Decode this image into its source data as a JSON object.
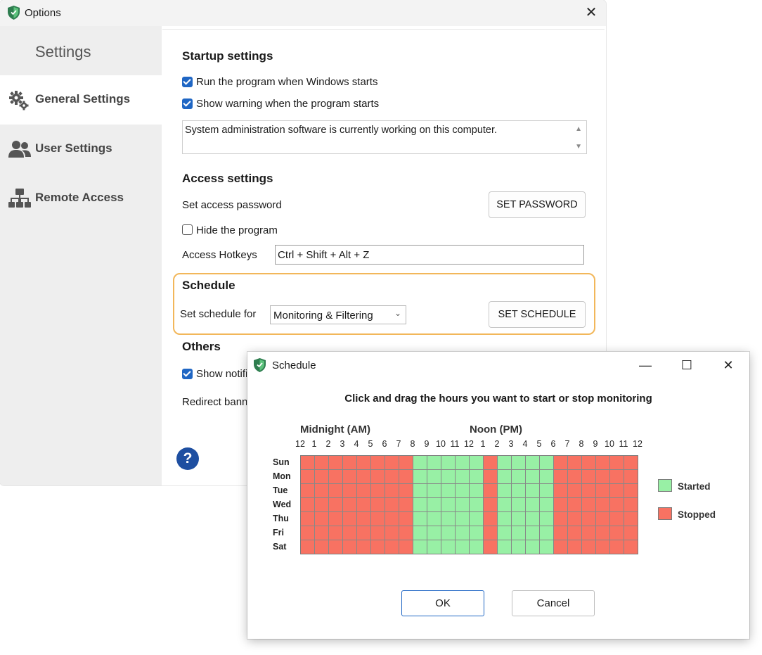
{
  "options_window": {
    "title": "Options",
    "app_icon": "shield-icon",
    "close_icon": "close-icon"
  },
  "sidebar": {
    "heading": "Settings",
    "items": [
      {
        "label": "General Settings",
        "icon": "gears-icon",
        "active": true
      },
      {
        "label": "User Settings",
        "icon": "users-icon",
        "active": false
      },
      {
        "label": "Remote Access",
        "icon": "network-icon",
        "active": false
      }
    ]
  },
  "startup": {
    "title": "Startup settings",
    "run_on_start": {
      "label": "Run the program when Windows starts",
      "checked": true
    },
    "show_warning": {
      "label": "Show warning when the program starts",
      "checked": true
    },
    "warning_message": "System administration software is currently working on this computer."
  },
  "access": {
    "title": "Access settings",
    "password_label": "Set access password",
    "password_button": "SET PASSWORD",
    "hide_program": {
      "label": "Hide the program",
      "checked": false
    },
    "hotkeys_label": "Access Hotkeys",
    "hotkeys_value": "Ctrl + Shift + Alt + Z"
  },
  "schedule_section": {
    "title": "Schedule",
    "for_label": "Set schedule for",
    "for_value": "Monitoring & Filtering",
    "button": "SET SCHEDULE",
    "highlight_color": "#f2b75a"
  },
  "others": {
    "title": "Others",
    "show_notif_label": "Show notifi",
    "show_notif_checked": true,
    "redirect_label": "Redirect bann"
  },
  "help_icon": "?",
  "schedule_dialog": {
    "title": "Schedule",
    "instruction": "Click and drag the hours you want to start or stop monitoring",
    "am_label": "Midnight (AM)",
    "pm_label": "Noon (PM)",
    "hour_labels": [
      "12",
      "1",
      "2",
      "3",
      "4",
      "5",
      "6",
      "7",
      "8",
      "9",
      "10",
      "11",
      "12",
      "1",
      "2",
      "3",
      "4",
      "5",
      "6",
      "7",
      "8",
      "9",
      "10",
      "11",
      "12"
    ],
    "days": [
      "Sun",
      "Mon",
      "Tue",
      "Wed",
      "Thu",
      "Fri",
      "Sat"
    ],
    "started_hours": [
      8,
      9,
      10,
      11,
      12,
      14,
      15,
      16,
      17
    ],
    "legend": {
      "started": "Started",
      "stopped": "Stopped"
    },
    "colors": {
      "started": "#98f0a5",
      "stopped": "#f87262"
    },
    "ok": "OK",
    "cancel": "Cancel"
  }
}
